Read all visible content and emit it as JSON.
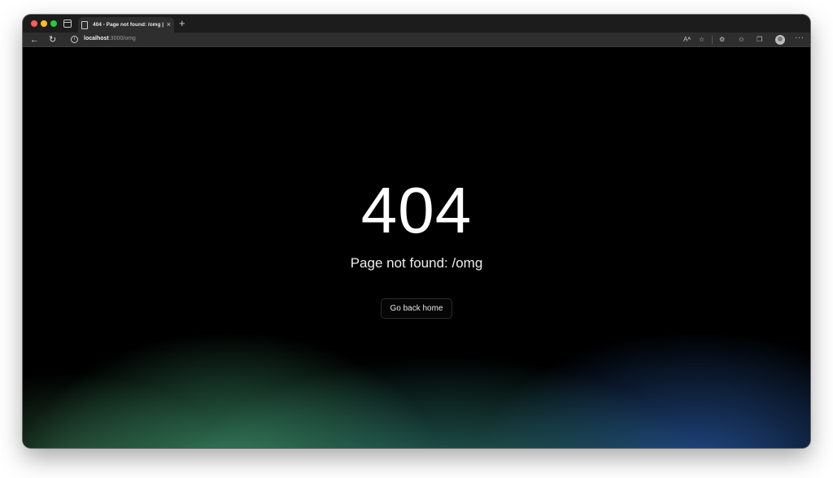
{
  "browser": {
    "tab": {
      "title": "404 - Page not found: /omg | N",
      "close": "×"
    },
    "new_tab": "+",
    "url": {
      "host": "localhost",
      "path": ":3000/omg"
    },
    "nav": {
      "back": "←",
      "reload": "↻",
      "info": "i"
    },
    "toolbar_icons": [
      "read-aloud-icon",
      "extensions-tab-icon",
      "extensions-icon",
      "favorites-icon",
      "collections-icon",
      "profile-icon",
      "more-icon"
    ],
    "toolbar_glyphs": {
      "read_aloud": "Aᴬ",
      "tab_fav": "☆",
      "extensions": "⚙",
      "favorites": "✩",
      "collections": "❐",
      "more": "···"
    }
  },
  "page": {
    "code": "404",
    "message": "Page not found: /omg",
    "button_label": "Go back home"
  },
  "colors": {
    "background": "#000000",
    "gradient_green": "#40966e",
    "gradient_teal": "#348c82",
    "gradient_blue": "#285aa5"
  }
}
